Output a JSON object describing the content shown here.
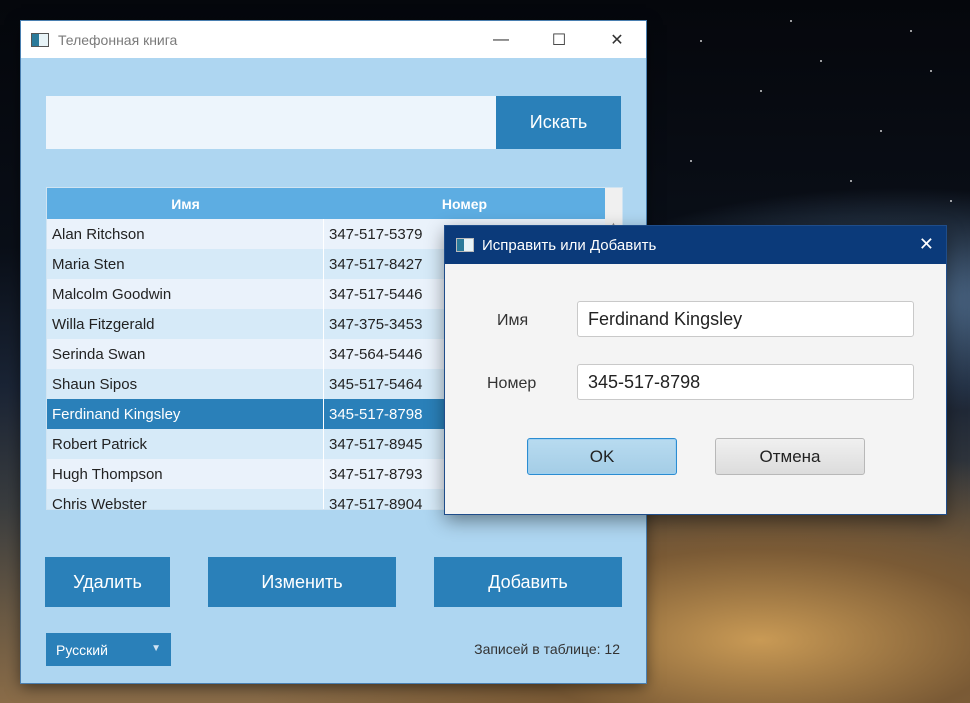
{
  "main_window": {
    "title": "Телефонная книга",
    "controls": {
      "minimize": "—",
      "maximize": "☐",
      "close": "✕"
    }
  },
  "search": {
    "placeholder": "",
    "button_label": "Искать"
  },
  "table": {
    "headers": {
      "name": "Имя",
      "number": "Номер"
    },
    "rows": [
      {
        "name": "Alan Ritchson",
        "number": "347-517-5379"
      },
      {
        "name": "Maria Sten",
        "number": "347-517-8427"
      },
      {
        "name": "Malcolm Goodwin",
        "number": "347-517-5446"
      },
      {
        "name": "Willa Fitzgerald",
        "number": "347-375-3453"
      },
      {
        "name": "Serinda Swan",
        "number": "347-564-5446"
      },
      {
        "name": "Shaun Sipos",
        "number": "345-517-5464"
      },
      {
        "name": "Ferdinand Kingsley",
        "number": "345-517-8798"
      },
      {
        "name": "Robert Patrick",
        "number": "347-517-8945"
      },
      {
        "name": "Hugh Thompson",
        "number": "347-517-8793"
      },
      {
        "name": "Chris Webster",
        "number": "347-517-8904"
      }
    ],
    "selected_row": 6
  },
  "actions": {
    "delete_label": "Удалить",
    "edit_label": "Изменить",
    "add_label": "Добавить"
  },
  "language": {
    "selected": "Русский"
  },
  "status": {
    "count_text": "Записей в таблице: 12"
  },
  "dialog": {
    "title": "Исправить или Добавить",
    "close": "✕",
    "name_label": "Имя",
    "name_value": "Ferdinand Kingsley",
    "number_label": "Номер",
    "number_value": "345-517-8798",
    "ok_label": "OK",
    "cancel_label": "Отмена"
  },
  "colors": {
    "accent": "#2a80b9",
    "window_bg": "#aed6f1",
    "header_bg": "#5dade2",
    "dialog_titlebar": "#0b3a7a"
  }
}
